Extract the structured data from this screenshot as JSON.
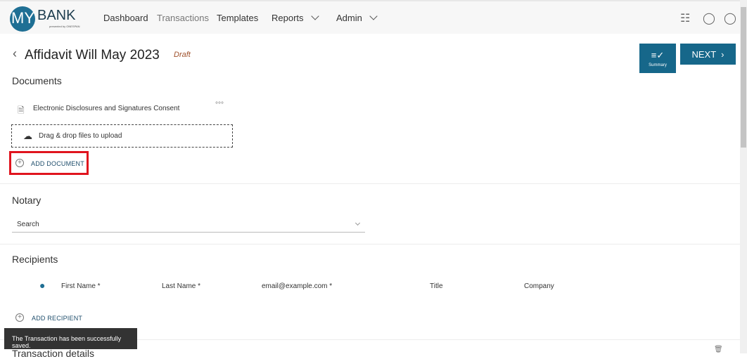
{
  "brand": {
    "logo_my": "MY",
    "logo_bank": "BANK",
    "logo_sub": "presented by ONESPAN",
    "accent": "#16678a"
  },
  "nav": {
    "items": [
      "Dashboard",
      "Transactions",
      "Templates",
      "Reports",
      "Admin"
    ]
  },
  "header": {
    "title": "Affidavit Will May 2023",
    "status": "Draft",
    "summary_label": "Summary",
    "next_label": "NEXT"
  },
  "documents": {
    "heading": "Documents",
    "items": [
      {
        "name": "Electronic Disclosures and Signatures Consent"
      }
    ],
    "dropzone": "Drag & drop files to upload",
    "add": "ADD DOCUMENT"
  },
  "notary": {
    "heading": "Notary",
    "placeholder": "Search"
  },
  "recipients": {
    "heading": "Recipients",
    "fields": {
      "first": "First Name *",
      "last": "Last Name *",
      "email": "email@example.com *",
      "title": "Title",
      "company": "Company"
    },
    "add": "ADD RECIPIENT"
  },
  "details": {
    "heading": "Transaction details"
  },
  "toast": "The Transaction has been successfully saved."
}
